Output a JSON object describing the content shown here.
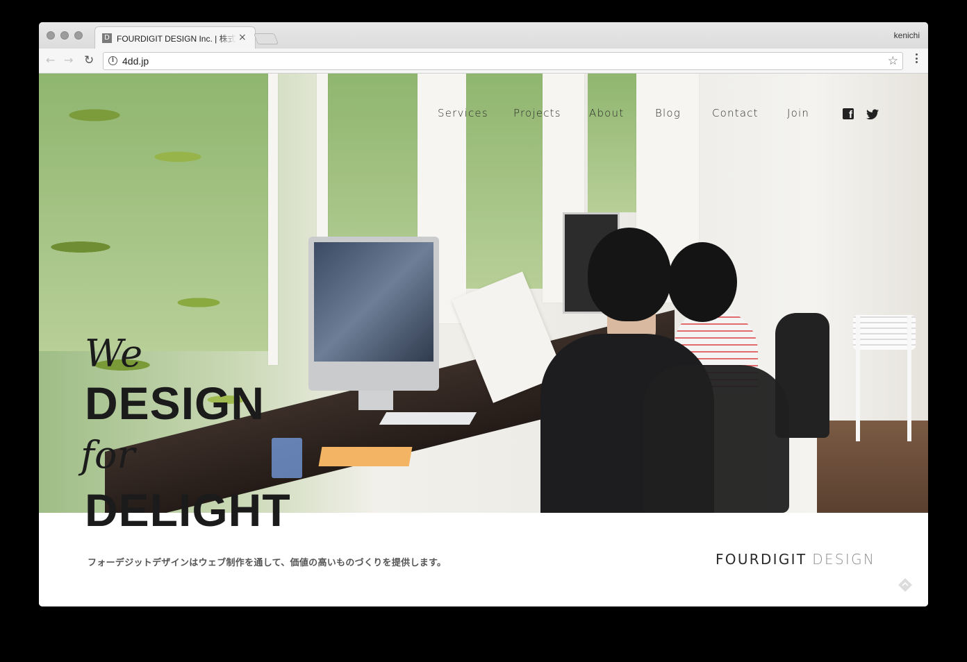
{
  "browser": {
    "tab_favicon": "D",
    "tab_title": "FOURDIGIT DESIGN Inc. | 株式会社フォーデジット",
    "tab_close": "×",
    "profile_name": "kenichi",
    "url": "4dd.jp",
    "icons": {
      "back": "arrow-left-icon",
      "forward": "arrow-right-icon",
      "reload": "reload-icon",
      "info": "info-icon",
      "bookmark": "star-icon",
      "menu": "menu-dots-icon"
    }
  },
  "nav": {
    "items": [
      "Services",
      "Projects",
      "About",
      "Blog",
      "Contact",
      "Join"
    ],
    "social": [
      "facebook-icon",
      "twitter-icon"
    ]
  },
  "hero": {
    "line1": "We",
    "line2": "DESIGN",
    "line3": "for",
    "line4": "DELIGHT"
  },
  "footer": {
    "tagline": "フォーデジットデザインはウェブ制作を通して、価値の高いものづくりを提供します。",
    "logo_primary": "FOURDIGIT",
    "logo_secondary": "DESIGN"
  },
  "colors": {
    "text_dark": "#1b1b1c",
    "logo_gray": "#8b8b8b",
    "background": "#ffffff"
  }
}
